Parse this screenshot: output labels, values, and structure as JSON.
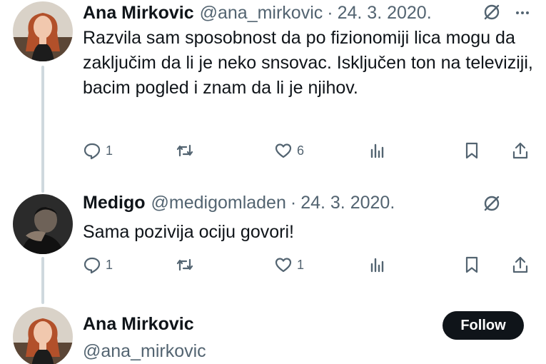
{
  "tweets": [
    {
      "name": "Ana Mirkovic",
      "handle": "@ana_mirkovic",
      "date": "24. 3. 2020.",
      "text": "Razvila sam sposobnost da po fizionomiji lica mogu da zaključim da li je neko snsovac. Isključen ton na televiziji, bacim pogled i znam da li je njihov.",
      "replies": "1",
      "reposts": "",
      "likes": "6"
    },
    {
      "name": "Medigo",
      "handle": "@medigomladen",
      "date": "24. 3. 2020.",
      "text": "Sama pozivija ociju govori!",
      "replies": "1",
      "reposts": "",
      "likes": "1"
    }
  ],
  "profile_card": {
    "name": "Ana Mirkovic",
    "handle": "@ana_mirkovic",
    "follow_label": "Follow"
  },
  "separator": "·",
  "colors": {
    "text": "#0f1419",
    "secondary": "#536471",
    "thread_line": "#cfd9de",
    "button_bg": "#0f1419"
  },
  "icons": [
    "grok-icon",
    "more-icon",
    "reply-icon",
    "repost-icon",
    "like-icon",
    "views-icon",
    "bookmark-icon",
    "share-icon"
  ]
}
